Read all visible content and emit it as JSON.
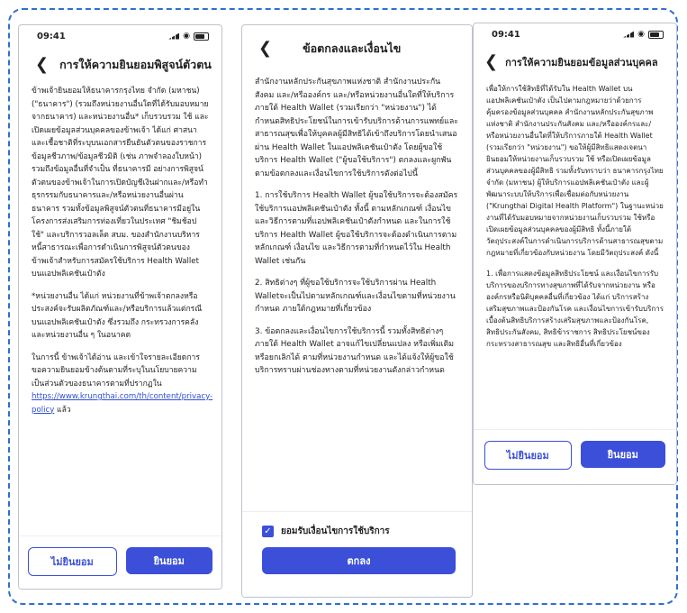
{
  "screen1": {
    "time": "09:41",
    "title": "การให้ความยินยอมพิสูจน์ตัวตน",
    "paragraphs": [
      "ข้าพเจ้ายินยอมให้ธนาคารกรุงไทย จำกัด (มหาชน) (\"ธนาคาร\") (รวมถึงหน่วยงานอื่นใดที่ได้รับมอบหมายจากธนาคาร) และหน่วยงานอื่น* เก็บรวบรวม ใช้ และเปิดเผยข้อมูลส่วนบุคคลของข้าพเจ้า ได้แก่ ศาสนาและเชื้อชาติที่ระบุบนเอกสารยืนยันตัวตนของราชการ ข้อมูลชีวภาพ/ข้อมูลชีวมิติ (เช่น ภาพจำลองใบหน้า) รวมถึงข้อมูลอื่นที่จำเป็น ที่ธนาคารมี อย่างการพิสูจน์ตัวตนของข้าพเจ้าในการเปิดบัญชีเงินฝากและ/หรือทำธุรกรรมกับธนาคารและ/หรือหน่วยงานอื่นผ่านธนาคาร รวมทั้งข้อมูลพิสูจน์ตัวตนที่ธนาคารมีอยู่ในโครงการส่งเสริมการท่องเที่ยวในประเทศ \"ชิมช้อปใช้\" และบริการวอลเล็ต สบม. ของสำนักงานบริหารหนี้สาธารณะเพื่อการดำเนินการพิสูจน์ตัวตนของข้าพเจ้าสำหรับการสมัครใช้บริการ Health Wallet บนแอปพลิเคชันเป๋าตัง",
      "*หน่วยงานอื่น ได้แก่ หน่วยงานที่ข้าพเจ้าตกลงหรือประสงค์จะรับผลิตภัณฑ์และ/หรือบริการแล้วแต่กรณี บนแอปพลิเคชันเป๋าตัง ซึ่งรวมถึง กระทรวงการคลังและหน่วยงานอื่น ๆ ในอนาคต",
      "ในการนี้ ข้าพเจ้าได้อ่าน และเข้าใจรายละเอียดการขอความยินยอมข้างต้นตามที่ระบุในนโยบายความเป็นส่วนตัวของธนาคารตามที่ปรากฏใน"
    ],
    "link_text": "https://www.krungthai.com/th/content/privacy-policy",
    "after_link": " แล้ว",
    "decline_label": "ไม่ยินยอม",
    "accept_label": "ยินยอม"
  },
  "screen2": {
    "title": "ข้อตกลงและเงื่อนไข",
    "paragraphs": [
      "สำนักงานหลักประกันสุขภาพแห่งชาติ สำนักงานประกันสังคม และ/หรือองค์กร และ/หรือหน่วยงานอื่นใดที่ให้บริการภายใต้ Health Wallet (รวมเรียกว่า \"หน่วยงาน\") ได้กำหนดสิทธิประโยชน์ในการเข้ารับบริการด้านการแพทย์และสาธารณสุขเพื่อให้บุคคลผู้มีสิทธิได้เข้าถึงบริการโดยนำเสนอผ่าน Health Wallet ในแอปพลิเคชันเป๋าตัง โดยผู้ขอใช้บริการ Health Wallet (\"ผู้ขอใช้บริการ\") ตกลงและผูกพันตามข้อตกลงและเงื่อนไขการใช้บริการดังต่อไปนี้",
      "1. การใช้บริการ Health Wallet ผู้ขอใช้บริการจะต้องสมัครใช้บริการแอปพลิเคชันเป๋าตัง ทั้งนี้ ตามหลักเกณฑ์ เงื่อนไข และวิธีการตามที่แอปพลิเคชันเป๋าตังกำหนด และในการใช้บริการ Health Wallet ผู้ขอใช้บริการจะต้องดำเนินการตามหลักเกณฑ์ เงื่อนไข และวิธีการตามที่กำหนดไว้ใน Health Wallet เช่นกัน",
      "2. สิทธิต่างๆ ที่ผู้ขอใช้บริการจะใช้บริการผ่าน Health Walletจะเป็นไปตามหลักเกณฑ์และเงื่อนไขตามที่หน่วยงานกำหนด ภายใต้กฎหมายที่เกี่ยวข้อง",
      "3. ข้อตกลงและเงื่อนไขการใช้บริการนี้ รวมทั้งสิทธิต่างๆ ภายใต้ Health Wallet อาจแก้ไขเปลี่ยนแปลง หรือเพิ่มเติม หรือยกเลิกได้ ตามที่หน่วยงานกำหนด และได้แจ้งให้ผู้ขอใช้บริการทราบผ่านช่องทางตามที่หน่วยงานดังกล่าวกำหนด"
    ],
    "checkbox_label": "ยอมรับเงื่อนไขการใช้บริการ",
    "ok_label": "ตกลง"
  },
  "screen3": {
    "time": "09:41",
    "title": "การให้ความยินยอมข้อมูลส่วนบุคคล",
    "paragraphs": [
      "เพื่อให้การใช้สิทธิที่ได้รับใน Health Wallet บนแอปพลิเคชันเป๋าตัง เป็นไปตามกฎหมายว่าด้วยการคุ้มครองข้อมูลส่วนบุคคล สำนักงานหลักประกันสุขภาพแห่งชาติ สำนักงานประกันสังคม และ/หรือองค์กรและ/หรือหน่วยงานอื่นใดที่ให้บริการภายใต้ Health Wallet (รวมเรียกว่า \"หน่วยงาน\") ขอให้ผู้มีสิทธิแสดงเจตนายินยอมให้หน่วยงานเก็บรวบรวม ใช้ หรือเปิดเผยข้อมูลส่วนบุคคลของผู้มีสิทธิ รวมทั้งรับทราบว่า ธนาคารกรุงไทย จำกัด (มหาชน) ผู้ให้บริการแอปพลิเคชันเป๋าตัง และผู้พัฒนาระบบให้บริการเพื่อเชื่อมต่อกับหน่วยงาน (\"Krungthai Digital Health Platform\") ในฐานะหน่วยงานที่ได้รับมอบหมายจากหน่วยงานเก็บรวบรวม ใช้หรือเปิดเผยข้อมูลส่วนบุคคลของผู้มีสิทธิ ทั้งนี้ภายใต้วัตถุประสงค์ในการดำเนินการบริการด้านสาธารณสุขตามกฎหมายที่เกี่ยวข้องกับหน่วยงาน โดยมีวัตถุประสงค์ ดังนี้",
      "1. เพื่อการแสดงข้อมูลสิทธิประโยชน์ และเงื่อนไขการรับบริการของบริการทางสุขภาพที่ได้รับจากหน่วยงาน หรือองค์กรหรือนิติบุคคลอื่นที่เกี่ยวข้อง ได้แก่ บริการสร้างเสริมสุขภาพและป้องกันโรค และเงื่อนไขการเข้ารับบริการเบื้องต้นสิทธิบริการสร้างเสริมสุขภาพและป้องกันโรค, สิทธิประกันสังคม, สิทธิข้าราชการ สิทธิประโยชน์ของกระทรวงสาธารณสุข และสิทธิอื่นที่เกี่ยวข้อง"
    ],
    "decline_label": "ไม่ยินยอม",
    "accept_label": "ยินยอม"
  }
}
